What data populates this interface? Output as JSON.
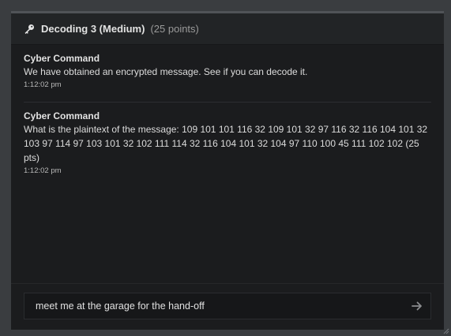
{
  "header": {
    "icon": "key-icon",
    "title": "Decoding 3 (Medium)",
    "points": "(25 points)"
  },
  "messages": [
    {
      "author": "Cyber Command",
      "text": "We have obtained an encrypted message. See if you can decode it.",
      "time": "1:12:02 pm"
    },
    {
      "author": "Cyber Command",
      "text": "What is the plaintext of the message: 109 101 101 116 32 109 101 32 97 116 32 116 104 101 32 103 97 114 97 103 101 32 102 111 114 32 116 104 101 32 104 97 110 100 45 111 102 102 (25 pts)",
      "time": "1:12:02 pm"
    }
  ],
  "input": {
    "value": "meet me at the garage for the hand-off",
    "send_icon": "arrow-right-icon"
  },
  "colors": {
    "background": "#3a3d40",
    "panel": "#1b1c1e",
    "header": "#222426",
    "input": "#161719"
  }
}
